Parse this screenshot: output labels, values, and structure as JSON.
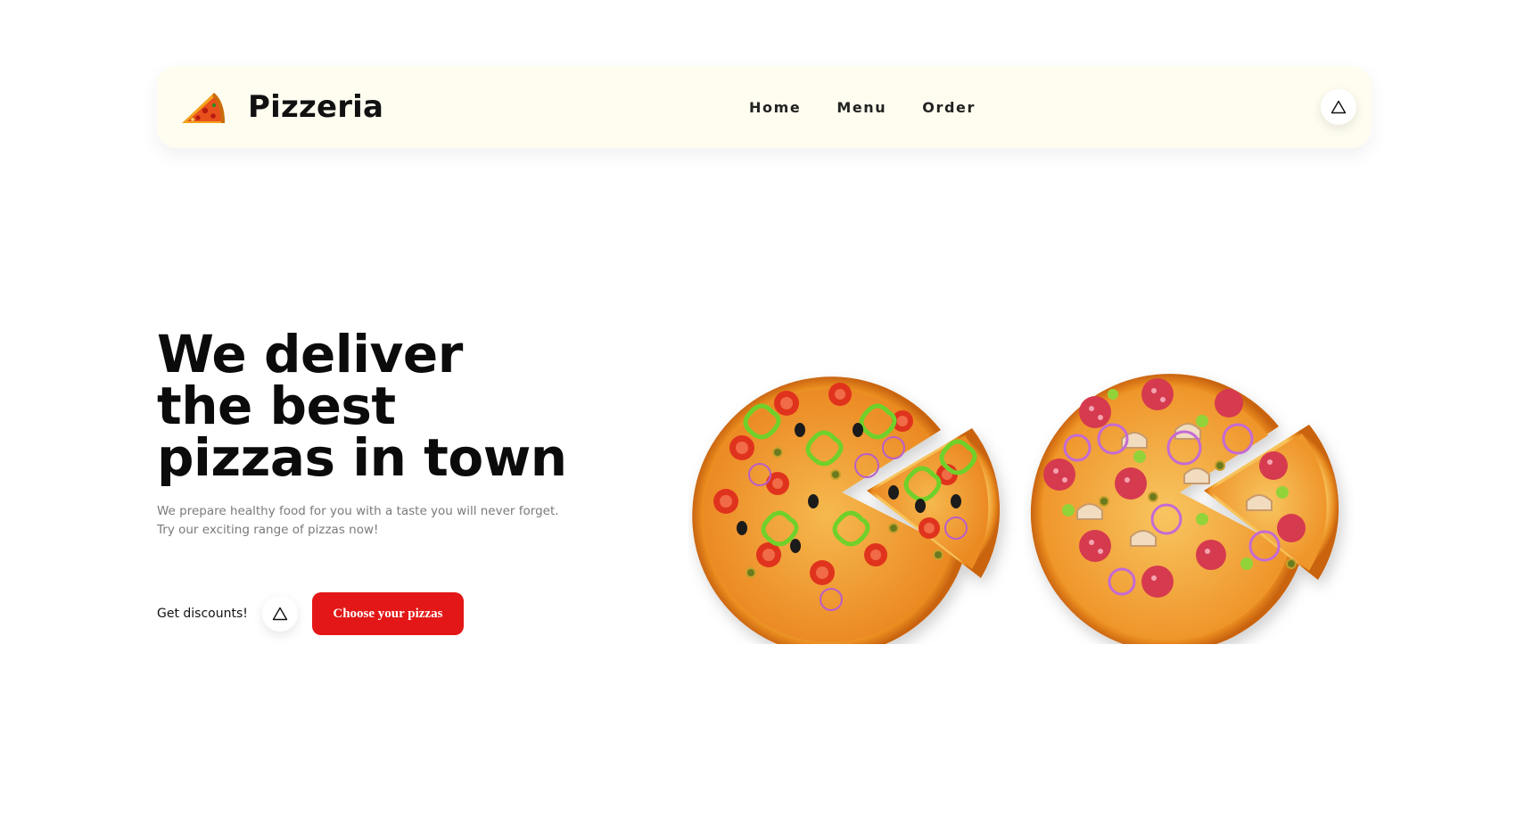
{
  "header": {
    "brand": "Pizzeria",
    "logo_icon": "pizza-slice-icon",
    "nav": [
      {
        "label": "Home"
      },
      {
        "label": "Menu"
      },
      {
        "label": "Order"
      }
    ],
    "action_icon": "triangle-icon"
  },
  "hero": {
    "title_lines": [
      "We deliver",
      "the best",
      "pizzas in town"
    ],
    "description_lines": [
      "We prepare healthy food for you with a taste you will never forget.",
      "Try our exciting range of pizzas now!"
    ],
    "discount_label": "Get discounts!",
    "discount_icon": "triangle-icon",
    "cta_label": "Choose your pizzas"
  },
  "images": [
    {
      "name": "vegetable-pizza",
      "content": "veggie pizza with one slice pulled out"
    },
    {
      "name": "salami-pizza",
      "content": "salami and mushroom pizza with one slice pulled out"
    }
  ],
  "colors": {
    "accent": "#e31717",
    "navbar_bg": "#fefdf0",
    "text": "#111111",
    "muted_text": "#7a7a7a"
  }
}
